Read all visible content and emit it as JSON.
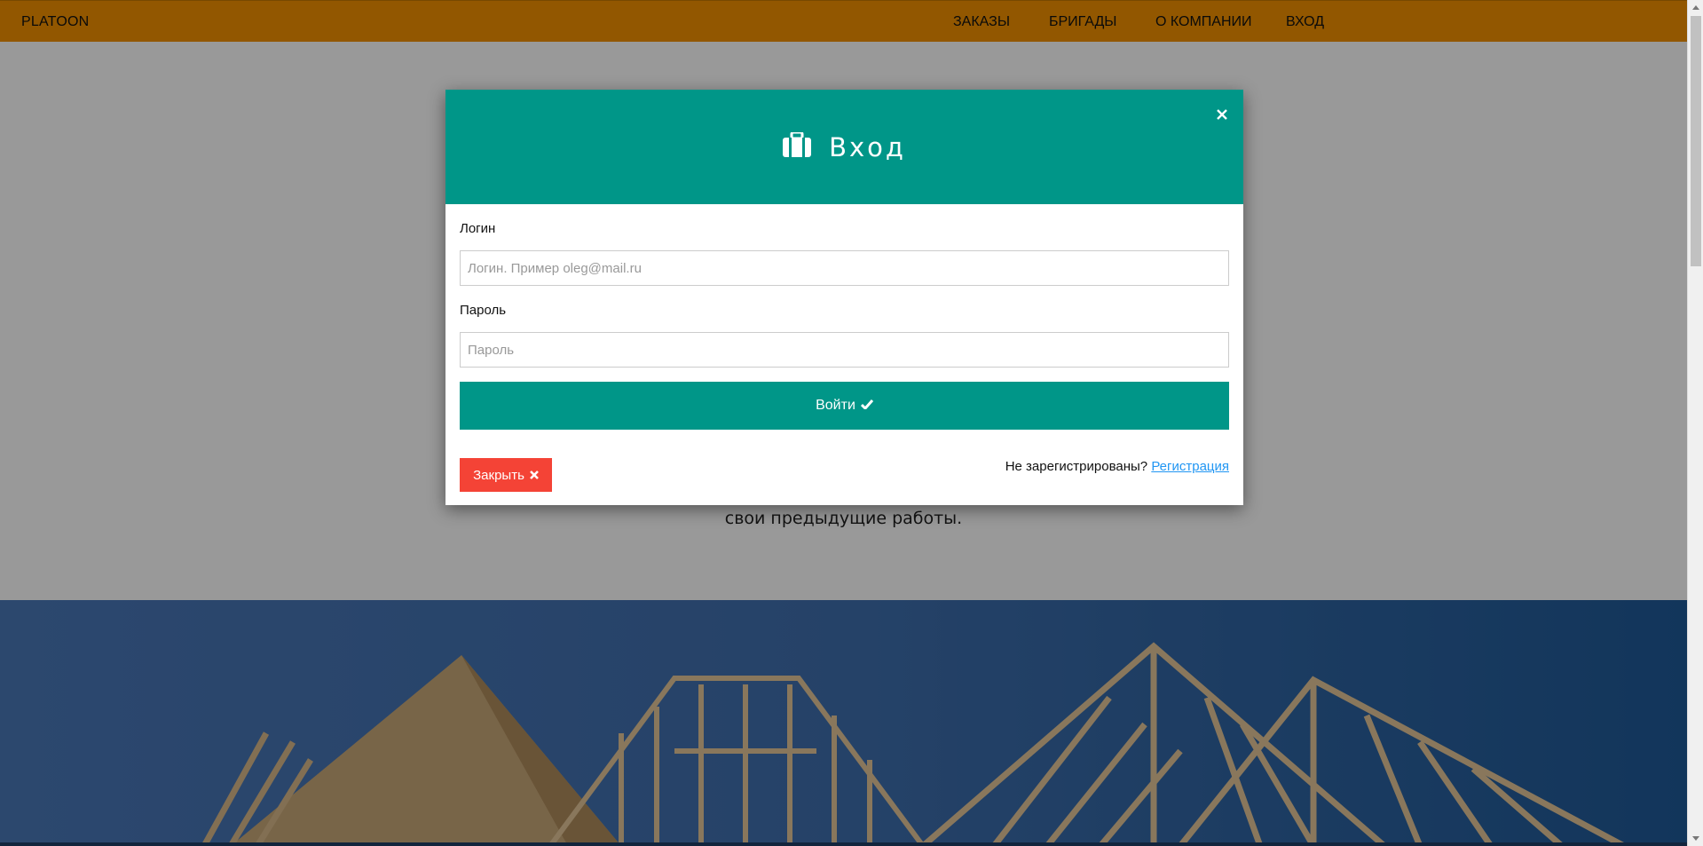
{
  "navbar": {
    "brand": "PLATOON",
    "items": [
      "ЗАКАЗЫ",
      "БРИГАДЫ",
      "О КОМПАНИИ",
      "ВХОД"
    ],
    "color": "#f39200"
  },
  "hero": {
    "text_fragment": "свои предыдущие работы."
  },
  "modal": {
    "title": "Вход",
    "header_icon": "briefcase-icon",
    "header_color": "#009688",
    "login_label": "Логин",
    "login_placeholder": "Логин. Пример oleg@mail.ru",
    "password_label": "Пароль",
    "password_placeholder": "Пароль",
    "submit_label": "Войти",
    "submit_icon": "check-icon",
    "close_label": "Закрыть",
    "close_icon": "times-icon",
    "close_color": "#f44336",
    "register_prompt": "Не зарегистрированы?",
    "register_link": "Регистрация"
  }
}
